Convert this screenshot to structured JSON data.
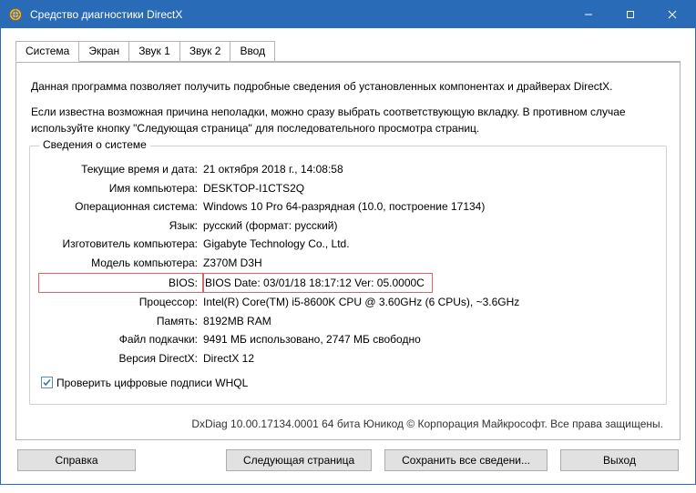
{
  "title": "Средство диагностики DirectX",
  "tabs": [
    "Система",
    "Экран",
    "Звук 1",
    "Звук 2",
    "Ввод"
  ],
  "description": {
    "p1": "Данная программа позволяет получить подробные сведения об установленных компонентах и драйверах DirectX.",
    "p2": "Если известна возможная причина неполадки, можно сразу выбрать соответствующую вкладку. В противном случае используйте кнопку \"Следующая страница\" для последовательного просмотра страниц."
  },
  "sysinfo_legend": "Сведения о системе",
  "sysinfo": {
    "datetime": {
      "label": "Текущие время и дата:",
      "value": "21 октября 2018 г., 14:08:58"
    },
    "pcname": {
      "label": "Имя компьютера:",
      "value": "DESKTOP-I1CTS2Q"
    },
    "os": {
      "label": "Операционная система:",
      "value": "Windows 10 Pro 64-разрядная (10.0, построение 17134)"
    },
    "lang": {
      "label": "Язык:",
      "value": "русский (формат: русский)"
    },
    "manufacturer": {
      "label": "Изготовитель компьютера:",
      "value": "Gigabyte Technology Co., Ltd."
    },
    "model": {
      "label": "Модель компьютера:",
      "value": "Z370M D3H"
    },
    "bios": {
      "label": "BIOS:",
      "value": "BIOS Date: 03/01/18 18:17:12 Ver: 05.0000C"
    },
    "cpu": {
      "label": "Процессор:",
      "value": "Intel(R) Core(TM) i5-8600K CPU @ 3.60GHz (6 CPUs), ~3.6GHz"
    },
    "ram": {
      "label": "Память:",
      "value": "8192MB RAM"
    },
    "pagefile": {
      "label": "Файл подкачки:",
      "value": "9491 МБ использовано, 2747 МБ свободно"
    },
    "dxver": {
      "label": "Версия DirectX:",
      "value": "DirectX 12"
    }
  },
  "checkbox_label": "Проверить цифровые подписи WHQL",
  "footer": "DxDiag 10.00.17134.0001 64 бита Юникод © Корпорация Майкрософт. Все права защищены.",
  "buttons": {
    "help": "Справка",
    "next": "Следующая страница",
    "save": "Сохранить все сведени...",
    "exit": "Выход"
  }
}
